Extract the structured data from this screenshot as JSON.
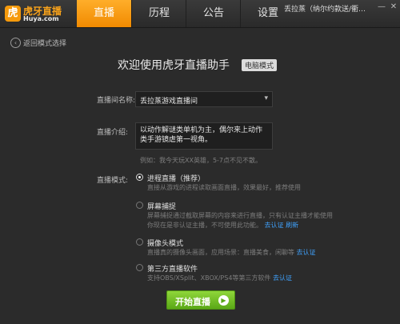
{
  "header": {
    "logo_name": "虎牙直播",
    "logo_sub": "Huya.com",
    "tabs": [
      "直播",
      "历程",
      "公告",
      "设置"
    ],
    "user": "丢拉蒸（纳尔约款送/衢…"
  },
  "back": {
    "label": "返回模式选择"
  },
  "welcome": {
    "title": "欢迎使用虎牙直播助手",
    "mode_badge": "电脑模式"
  },
  "form": {
    "room_name_label": "直播间名称:",
    "room_name_value": "丢拉蒸游戏直播间",
    "intro_label": "直播介绍:",
    "intro_text": "以动作解谜类单机为主，偶尔来上动作类手游镜虐第一视角。",
    "intro_hint": "例如：我今天玩XX英雄，5-7点不见不散。",
    "mode_label": "直播模式:"
  },
  "modes": [
    {
      "title": "进程直播（推荐）",
      "desc": [
        "直接从游戏的进程读取画面直播，效果最好，推荐使用"
      ],
      "selected": true
    },
    {
      "title": "屏幕捕捉",
      "desc": [
        "屏幕捕捉通过截取屏幕的内容来进行直播，只有认证主播才能使用",
        "你现在是非认证主播，不可使用此功能。"
      ],
      "links": [
        "去认证",
        "刷新"
      ]
    },
    {
      "title": "摄像头模式",
      "desc": [
        "直播真的摄像头画面，应用场景：直播美食，闲聊等"
      ],
      "links": [
        "去认证"
      ]
    },
    {
      "title": "第三方直播软件",
      "desc": [
        "支持OBS/XSplit、XBOX/PS4等第三方软件"
      ],
      "links": [
        "去认证"
      ]
    }
  ],
  "start": {
    "label": "开始直播"
  }
}
